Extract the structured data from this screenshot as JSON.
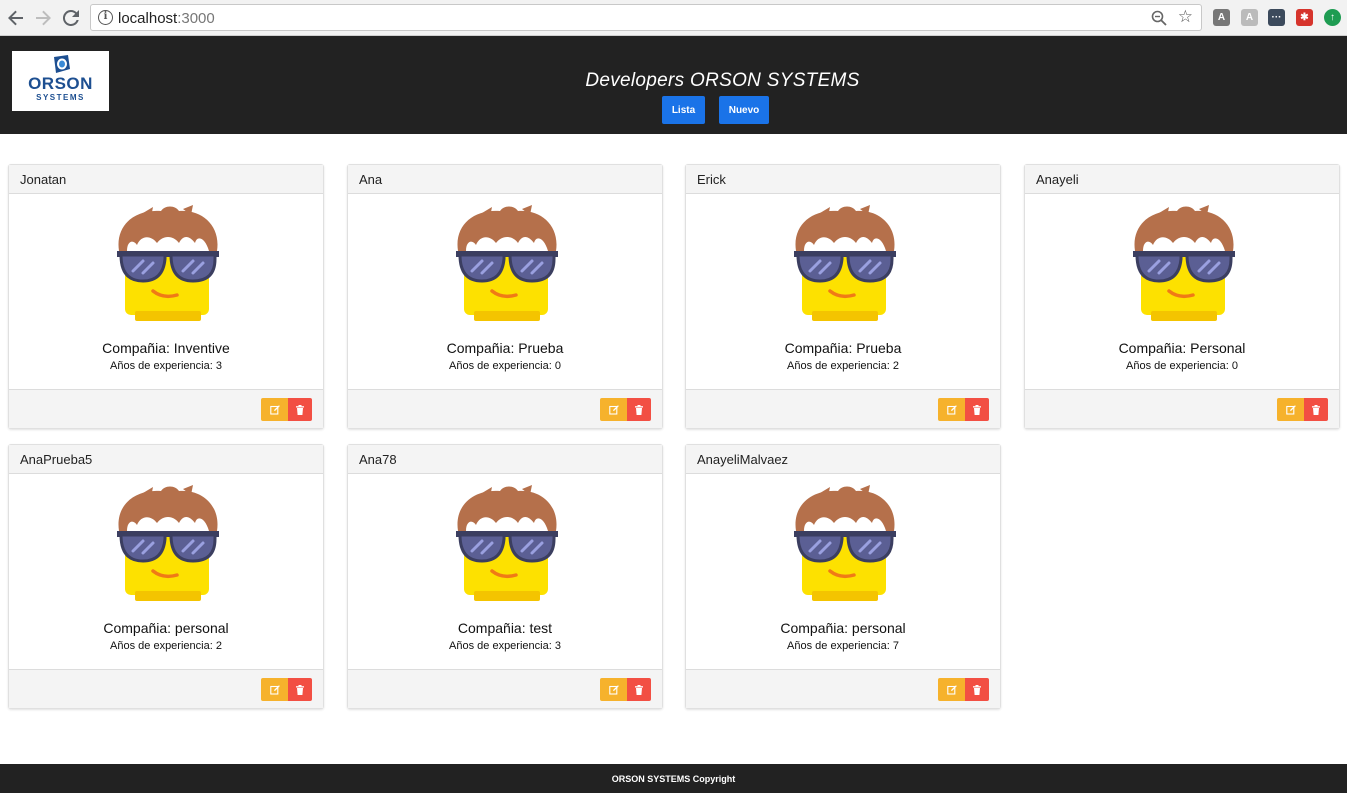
{
  "browser": {
    "url_host": "localhost",
    "url_port": ":3000"
  },
  "header": {
    "logo_text": "ORSON",
    "logo_subtext": "SYSTEMS",
    "title": "Developers ORSON SYSTEMS",
    "list_button": "Lista",
    "new_button": "Nuevo",
    "background": "#222222",
    "button_color": "#1a73e8"
  },
  "developers": [
    {
      "name": "Jonatan",
      "company": "Compañia: Inventive",
      "experience": "Años de experiencia: 3"
    },
    {
      "name": "Ana",
      "company": "Compañia: Prueba",
      "experience": "Años de experiencia: 0"
    },
    {
      "name": "Erick",
      "company": "Compañia: Prueba",
      "experience": "Años de experiencia: 2"
    },
    {
      "name": "Anayeli",
      "company": "Compañia: Personal",
      "experience": "Años de experiencia: 0"
    },
    {
      "name": "AnaPrueba5",
      "company": "Compañia: personal",
      "experience": "Años de experiencia: 2"
    },
    {
      "name": "Ana78",
      "company": "Compañia: test",
      "experience": "Años de experiencia: 3"
    },
    {
      "name": "AnayeliMalvaez",
      "company": "Compañia: personal",
      "experience": "Años de experiencia: 7"
    }
  ],
  "card_actions": {
    "edit_icon": "edit-icon",
    "delete_icon": "trash-icon",
    "edit_color": "#f6b22c",
    "delete_color": "#f24f43"
  },
  "footer": {
    "text": "ORSON SYSTEMS Copyright"
  }
}
